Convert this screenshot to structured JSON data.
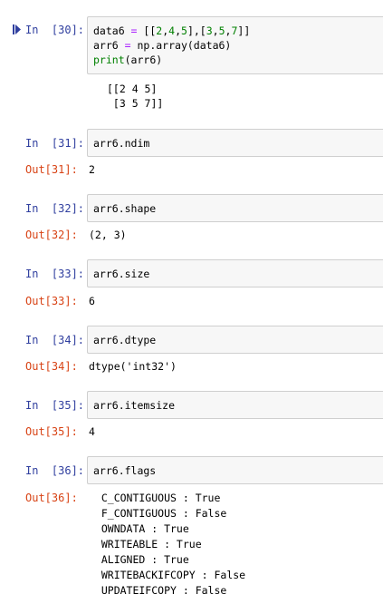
{
  "cells": [
    {
      "in_prompt": "In  [30]:",
      "code_lines": [
        {
          "a": "data6 ",
          "op": "=",
          "b": " [[",
          "n1": "2",
          "c1": ",",
          "n2": "4",
          "c2": ",",
          "n3": "5",
          "c3": "],[",
          "n4": "3",
          "c4": ",",
          "n5": "5",
          "c5": ",",
          "n6": "7",
          "c6": "]]"
        },
        {
          "a": "arr6 ",
          "op": "=",
          "b": " np.array(data6)"
        },
        {
          "fn": "print",
          "rest": "(arr6)"
        }
      ],
      "stdout": [
        "[[2 4 5]",
        " [3 5 7]]"
      ]
    },
    {
      "in_prompt": "In  [31]:",
      "code": "arr6.ndim",
      "out_prompt": "Out[31]:",
      "output": "2"
    },
    {
      "in_prompt": "In  [32]:",
      "code": "arr6.shape",
      "out_prompt": "Out[32]:",
      "output": "(2, 3)"
    },
    {
      "in_prompt": "In  [33]:",
      "code": "arr6.size",
      "out_prompt": "Out[33]:",
      "output": "6"
    },
    {
      "in_prompt": "In  [34]:",
      "code": "arr6.dtype",
      "out_prompt": "Out[34]:",
      "output": "dtype('int32')"
    },
    {
      "in_prompt": "In  [35]:",
      "code": "arr6.itemsize",
      "out_prompt": "Out[35]:",
      "output": "4"
    },
    {
      "in_prompt": "In  [36]:",
      "code": "arr6.flags",
      "out_prompt": "Out[36]:",
      "output_lines": [
        "  C_CONTIGUOUS : True",
        "  F_CONTIGUOUS : False",
        "  OWNDATA : True",
        "  WRITEABLE : True",
        "  ALIGNED : True",
        "  WRITEBACKIFCOPY : False",
        "  UPDATEIFCOPY : False"
      ]
    }
  ],
  "colors": {
    "in_prompt": "#303f9f",
    "out_prompt": "#d84315",
    "cell_bg": "#f7f7f7",
    "cell_border": "#cfcfcf",
    "keyword_op": "#aa22ff",
    "number": "#008000",
    "builtin": "#008000"
  },
  "icons": {
    "run_marker": "step-forward-icon"
  }
}
